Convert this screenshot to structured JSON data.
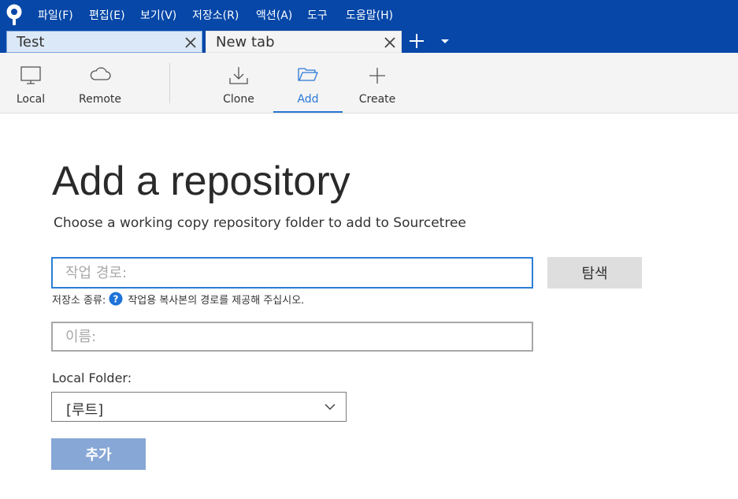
{
  "app": {
    "logo": "sourcetree-logo"
  },
  "menu": {
    "items": [
      {
        "label": "파일(F)"
      },
      {
        "label": "편집(E)"
      },
      {
        "label": "보기(V)"
      },
      {
        "label": "저장소(R)"
      },
      {
        "label": "액션(A)"
      },
      {
        "label": "도구"
      },
      {
        "label": "도움말(H)"
      }
    ]
  },
  "tabs": {
    "items": [
      {
        "label": "Test",
        "selected": false
      },
      {
        "label": "New tab",
        "selected": true
      }
    ],
    "icons": {
      "close": "close-icon",
      "add": "plus-icon",
      "menu": "caret-down-icon"
    }
  },
  "toolbar": {
    "items": [
      {
        "label": "Local",
        "icon": "monitor-icon"
      },
      {
        "label": "Remote",
        "icon": "cloud-icon"
      },
      {
        "label": "Clone",
        "icon": "download-icon"
      },
      {
        "label": "Add",
        "icon": "folder-open-icon",
        "active": true
      },
      {
        "label": "Create",
        "icon": "plus-icon"
      }
    ]
  },
  "form": {
    "title": "Add a repository",
    "subtitle": "Choose a working copy repository folder to add to Sourcetree",
    "path": {
      "value": "",
      "placeholder": "작업 경로:"
    },
    "browse_label": "탐색",
    "repo_type": {
      "label": "저장소 종류:",
      "message": "작업용 복사본의 경로를 제공해 주십시오.",
      "icon": "help-icon"
    },
    "name": {
      "value": "",
      "placeholder": "이름:"
    },
    "local_folder": {
      "label": "Local Folder:",
      "selected": "[루트]",
      "icon": "chevron-down-icon"
    },
    "add_label": "추가"
  },
  "colors": {
    "menubar": "#0647a8",
    "accent": "#2b78d6",
    "add_button": "#87a7d6",
    "browse_button": "#dedede",
    "help_icon": "#1e73d8"
  }
}
